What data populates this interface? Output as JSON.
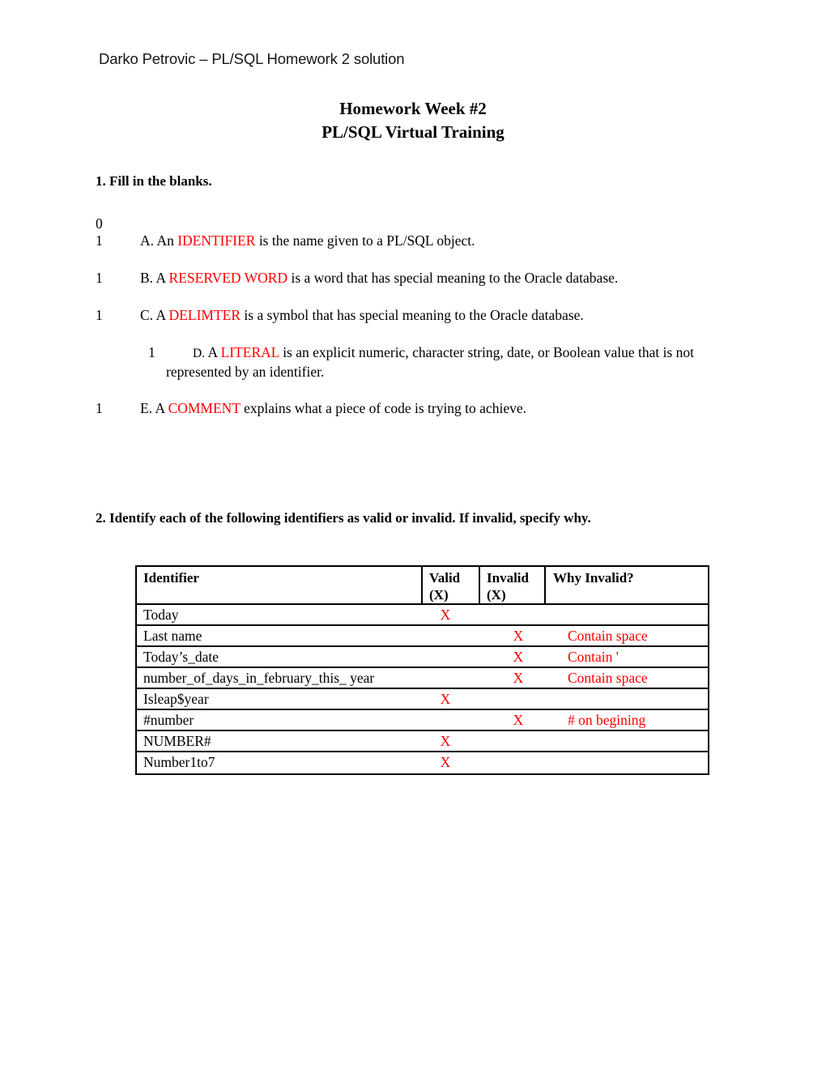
{
  "document": {
    "running_header": "Darko Petrovic – PL/SQL Homework 2 solution",
    "title_line1": "Homework Week #2",
    "title_line2": "PL/SQL Virtual Training"
  },
  "colors": {
    "answer_red": "#FF0000",
    "text_black": "#000000",
    "page_background": "#FFFFFF"
  },
  "question1": {
    "heading": "1.  Fill in the blanks.",
    "margin_zero": "0",
    "items": [
      {
        "margin_number": "1",
        "label": "A.",
        "text_before": "An ",
        "answer": "IDENTIFIER",
        "text_after": " is the name given to a PL/SQL object."
      },
      {
        "margin_number": "1",
        "label": "B.",
        "text_before": "A ",
        "answer": "RESERVED WORD",
        "text_after": " is a word that has special meaning to the Oracle database."
      },
      {
        "margin_number": "1",
        "label": "C.",
        "text_before": "A ",
        "answer": "DELIMTER",
        "text_after": " is a symbol that has special meaning to the Oracle database."
      },
      {
        "margin_number": "1",
        "label": "D.",
        "text_before": "A ",
        "answer": "LITERAL",
        "text_after": " is an explicit numeric, character string, date, or Boolean value that is not represented by an identifier."
      },
      {
        "margin_number": "1",
        "label": "E.",
        "text_before": "A ",
        "answer": "COMMENT",
        "text_after": " explains what a piece of code is trying to achieve."
      }
    ]
  },
  "question2": {
    "heading": "2.  Identify each of the following identifiers as valid or invalid. If invalid, specify why.",
    "table": {
      "columns": [
        "Identifier",
        "Valid (X)",
        "Invalid (X)",
        "Why Invalid?"
      ],
      "header_cells": {
        "identifier": "Identifier",
        "valid_line1": "Valid",
        "valid_line2": "(X)",
        "invalid_line1": "Invalid",
        "invalid_line2": "(X)",
        "why": "Why Invalid?"
      },
      "rows": [
        {
          "identifier": "Today",
          "valid": "X",
          "invalid": "",
          "why": ""
        },
        {
          "identifier": "Last name",
          "valid": "",
          "invalid": "X",
          "why": "Contain space"
        },
        {
          "identifier": "Today’s_date",
          "valid": "",
          "invalid": "X",
          "why": "Contain '"
        },
        {
          "identifier": "number_of_days_in_february_this_ year",
          "valid": "",
          "invalid": "X",
          "why": "Contain space"
        },
        {
          "identifier": "Isleap$year",
          "valid": "X",
          "invalid": "",
          "why": ""
        },
        {
          "identifier": "#number",
          "valid": "",
          "invalid": "X",
          "why": "# on begining"
        },
        {
          "identifier": "NUMBER#",
          "valid": "X",
          "invalid": "",
          "why": ""
        },
        {
          "identifier": "Number1to7",
          "valid": "X",
          "invalid": "",
          "why": ""
        }
      ]
    }
  }
}
